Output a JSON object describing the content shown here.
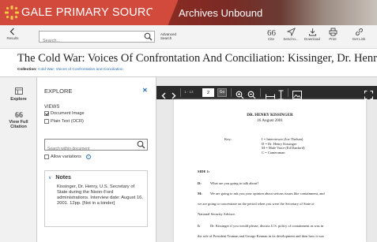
{
  "header": {
    "brand": "GALE PRIMARY SOURCES",
    "collection": "Archives Unbound",
    "brand_color": "#d24a3b"
  },
  "toolbar": {
    "back_label": "Results",
    "search_placeholder": "Search...",
    "advanced_search": "Advanced Search",
    "actions": [
      {
        "icon": "cite-icon",
        "label": "Cite"
      },
      {
        "icon": "send-icon",
        "label": "Send to..."
      },
      {
        "icon": "download-icon",
        "label": "Download"
      },
      {
        "icon": "print-icon",
        "label": "Print"
      },
      {
        "icon": "link-icon",
        "label": "Get Link"
      }
    ]
  },
  "document": {
    "title": "The Cold War: Voices Of Confrontation And Conciliation: Kissinger, Dr. Henry",
    "collection_label": "Collection:",
    "collection_value": "Cold War: Voices of Confrontation and Conciliation"
  },
  "rail": {
    "explore": "Explore",
    "full_citation": "View Full Citation"
  },
  "explore": {
    "heading": "EXPLORE",
    "views_label": "VIEWS",
    "view_document_image": "Document Image",
    "view_plain_text": "Plain Text (OCR)",
    "search_within_placeholder": "Search within document",
    "allow_variations": "Allow variations",
    "notes_heading": "Notes",
    "notes_text": "Kissinger, Dr. Henry, U.S. Secretary of State during the Nixon-Ford administrations. Interview date: August 16, 2001. 12pp. [Not in a binder]"
  },
  "viewer": {
    "page_of": "1 - 13",
    "current_page": "2",
    "go": "Go"
  },
  "page_content": {
    "heading": "DR. HENRY KISSINGER",
    "date": "16 August 2001",
    "key_label": "Key:",
    "key_lines": [
      "I = Interviewer (Joe Thelsen)",
      "D = Dr. Henry Kissinger",
      "M = Male Voice (Ed Danford)",
      "C = Cameraman"
    ],
    "side": "SIDE 1:",
    "lines": [
      {
        "speaker": "D:",
        "text": "What are you going to talk about?"
      },
      {
        "speaker": "M:",
        "text": "We are going to ask you your opinion about serious issues like containment, and"
      },
      {
        "speaker": "",
        "text": "we are going to concentrate on the period when you were the Secretary of State or"
      },
      {
        "speaker": "",
        "text": "National Security Advisor."
      },
      {
        "speaker": "I:",
        "text": "Dr. Kissinger if you would please, discuss U.S. policy of containment as was in"
      },
      {
        "speaker": "",
        "text": "the role of President Truman and George Kennan in its development and then how it was"
      }
    ]
  }
}
